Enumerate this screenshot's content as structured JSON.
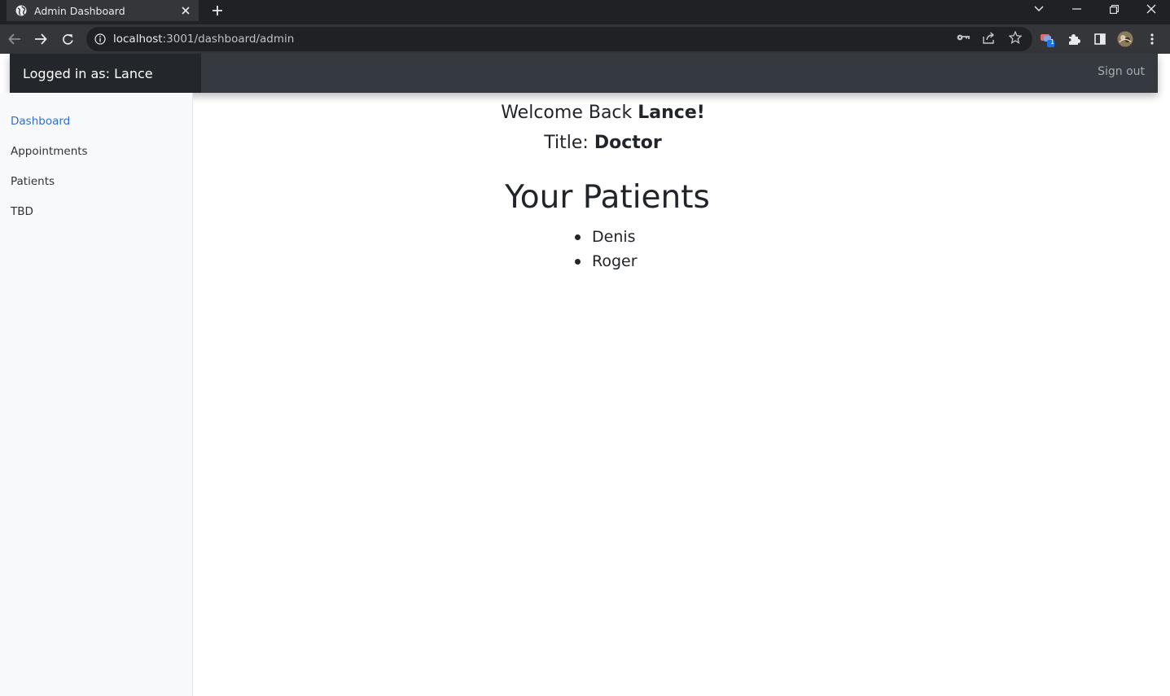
{
  "browser": {
    "tab_title": "Admin Dashboard",
    "url_host": "localhost",
    "url_rest": ":3001/dashboard/admin",
    "extension_badge": "1"
  },
  "header": {
    "brand": "Logged in as: Lance",
    "sign_out": "Sign out"
  },
  "sidebar": {
    "items": [
      {
        "label": "Dashboard",
        "active": true
      },
      {
        "label": "Appointments",
        "active": false
      },
      {
        "label": "Patients",
        "active": false
      },
      {
        "label": "TBD",
        "active": false
      }
    ]
  },
  "main": {
    "welcome_prefix": "Welcome Back ",
    "welcome_name": "Lance!",
    "title_prefix": "Title: ",
    "title_value": "Doctor",
    "patients_heading": "Your Patients",
    "patients": [
      "Denis",
      "Roger"
    ]
  },
  "colors": {
    "header_bg": "#343a40",
    "brand_bg": "#23272b",
    "sidebar_bg": "#f8f9fa",
    "active_link": "#2f6fd1"
  }
}
